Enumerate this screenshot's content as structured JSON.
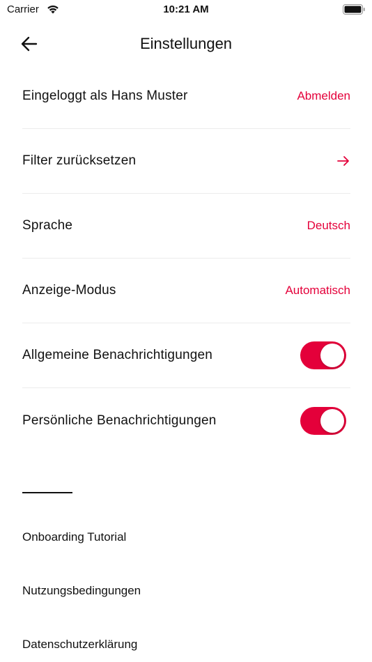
{
  "status_bar": {
    "carrier": "Carrier",
    "time": "10:21 AM"
  },
  "nav": {
    "title": "Einstellungen",
    "back_icon": "arrow-left-icon"
  },
  "settings": {
    "account": {
      "label": "Eingeloggt als Hans Muster",
      "action": "Abmelden"
    },
    "reset_filter": {
      "label": "Filter zurücksetzen",
      "icon": "arrow-right-icon"
    },
    "language": {
      "label": "Sprache",
      "value": "Deutsch"
    },
    "display_mode": {
      "label": "Anzeige-Modus",
      "value": "Automatisch"
    },
    "general_notifications": {
      "label": "Allgemeine Benachrichtigungen",
      "enabled": true
    },
    "personal_notifications": {
      "label": "Persönliche Benachrichtigungen",
      "enabled": true
    }
  },
  "links": [
    {
      "label": "Onboarding Tutorial"
    },
    {
      "label": "Nutzungsbedingungen"
    },
    {
      "label": "Datenschutzerklärung"
    }
  ],
  "colors": {
    "accent": "#e4003a",
    "text": "#111111",
    "separator": "#ececec"
  }
}
